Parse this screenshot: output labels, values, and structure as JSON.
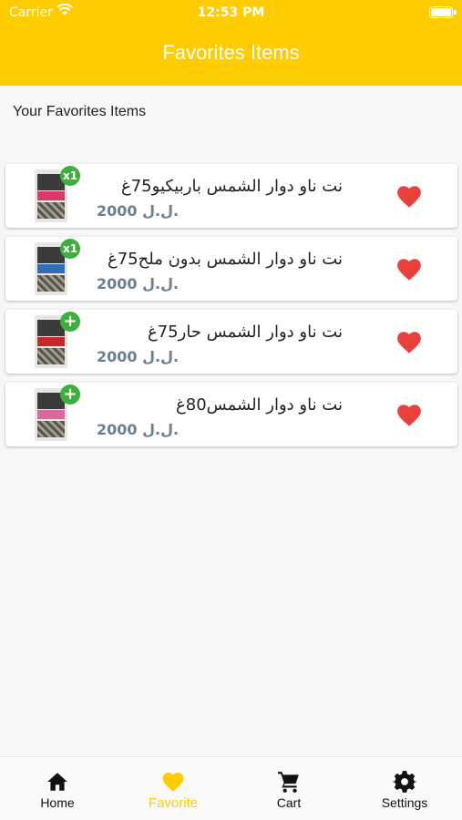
{
  "status_bar": {
    "carrier": "Carrier",
    "time": "12:53 PM"
  },
  "header": {
    "title": "Favorites Items"
  },
  "section_title": "Your Favorites Items",
  "items": [
    {
      "name": "نت ناو دوار الشمس باربيكيو75غ",
      "price": "2000 ل.ل.",
      "badge": "x1",
      "favorite": true
    },
    {
      "name": "نت ناو دوار الشمس بدون ملح75غ",
      "price": "2000 ل.ل.",
      "badge": "x1",
      "favorite": true
    },
    {
      "name": "نت ناو دوار الشمس حار75غ",
      "price": "2000 ل.ل.",
      "badge": "+",
      "favorite": true
    },
    {
      "name": "نت ناو دوار الشمس80غ",
      "price": "2000 ل.ل.",
      "badge": "+",
      "favorite": true
    }
  ],
  "tabs": [
    {
      "label": "Home",
      "icon": "home-icon",
      "active": false
    },
    {
      "label": "Favorite",
      "icon": "heart-icon",
      "active": true
    },
    {
      "label": "Cart",
      "icon": "cart-icon",
      "active": false
    },
    {
      "label": "Settings",
      "icon": "gear-icon",
      "active": false
    }
  ],
  "colors": {
    "accent": "#ffcc00",
    "badge": "#3eae3e",
    "heart": "#e8403a",
    "price": "#6b7f8f"
  }
}
